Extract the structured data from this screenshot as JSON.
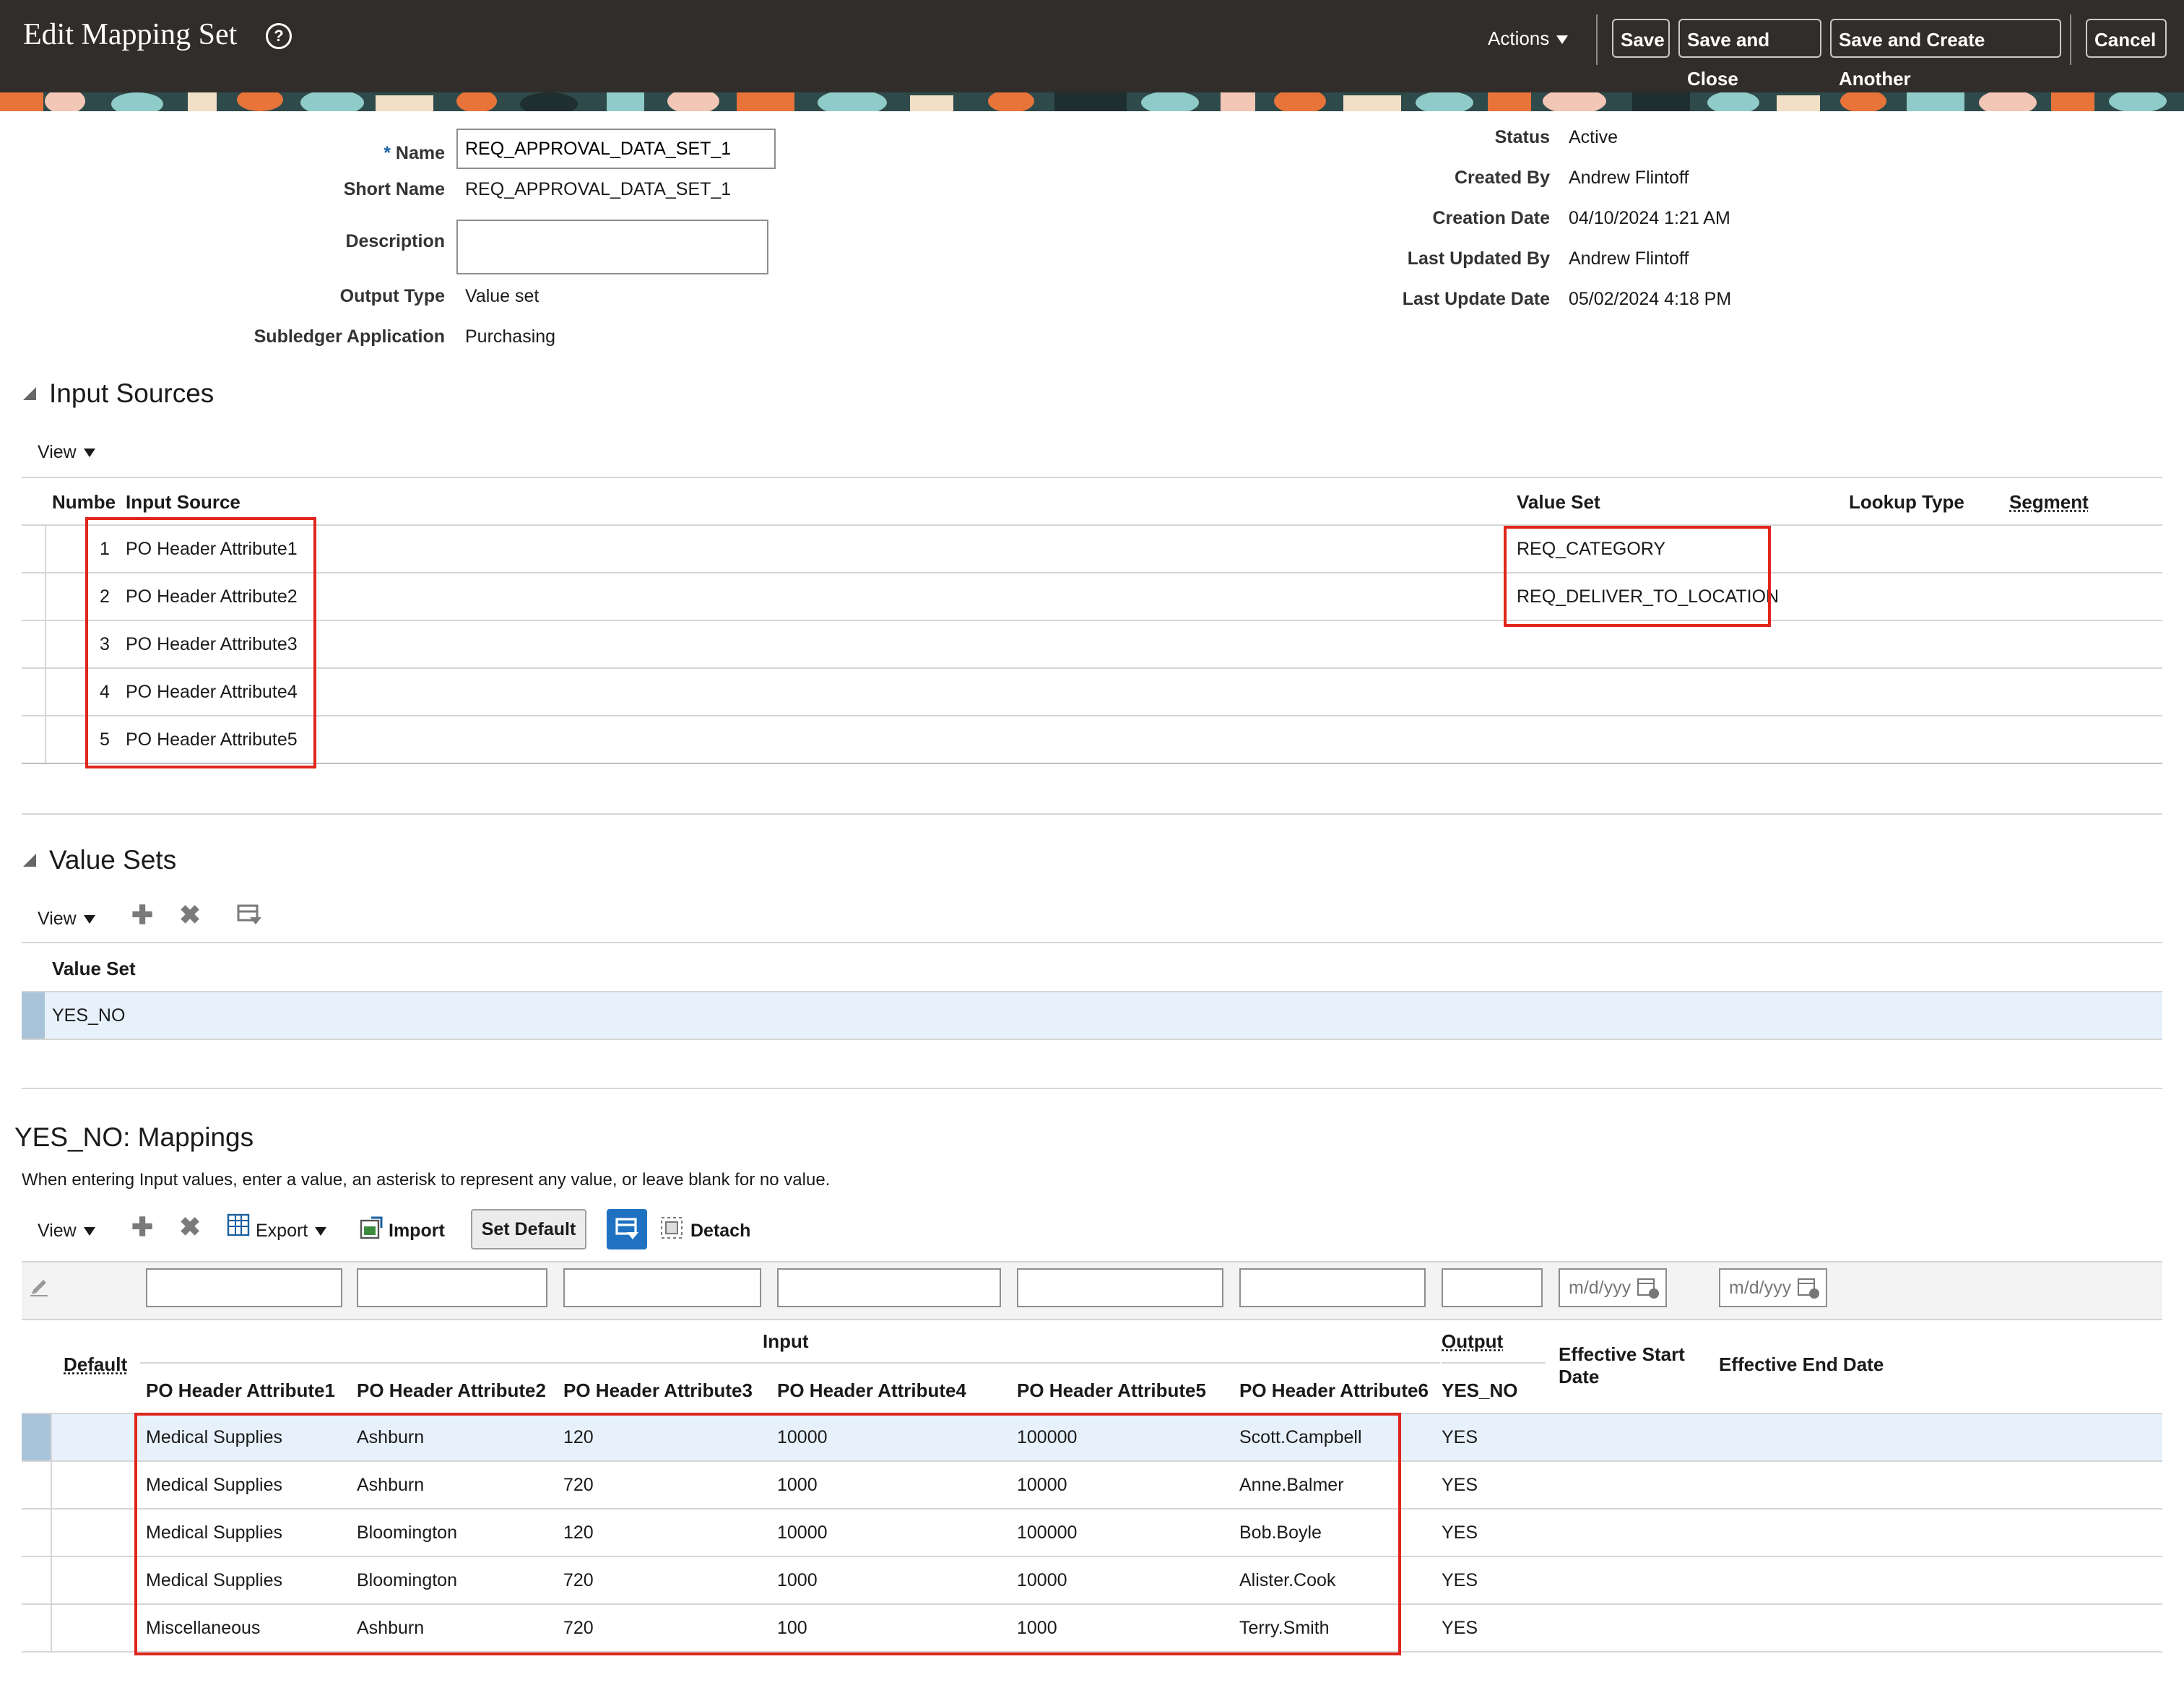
{
  "header": {
    "title": "Edit Mapping Set",
    "actions_label": "Actions",
    "buttons": {
      "save": "Save",
      "save_close": "Save and Close",
      "save_create": "Save and Create Another",
      "cancel": "Cancel"
    }
  },
  "form": {
    "name_label": "Name",
    "name_value": "REQ_APPROVAL_DATA_SET_1",
    "short_name_label": "Short Name",
    "short_name_value": "REQ_APPROVAL_DATA_SET_1",
    "description_label": "Description",
    "description_value": "",
    "output_type_label": "Output Type",
    "output_type_value": "Value set",
    "subledger_label": "Subledger Application",
    "subledger_value": "Purchasing",
    "status_label": "Status",
    "status_value": "Active",
    "created_by_label": "Created By",
    "created_by_value": "Andrew Flintoff",
    "creation_date_label": "Creation Date",
    "creation_date_value": "04/10/2024 1:21 AM",
    "updated_by_label": "Last Updated By",
    "updated_by_value": "Andrew Flintoff",
    "update_date_label": "Last Update Date",
    "update_date_value": "05/02/2024 4:18 PM"
  },
  "input_sources": {
    "title": "Input Sources",
    "view_label": "View",
    "columns": {
      "number": "Numbe",
      "source": "Input Source",
      "value_set": "Value Set",
      "lookup": "Lookup Type",
      "segment": "Segment"
    },
    "rows": [
      {
        "num": "1",
        "source": "PO Header Attribute1",
        "value_set": "REQ_CATEGORY"
      },
      {
        "num": "2",
        "source": "PO Header Attribute2",
        "value_set": "REQ_DELIVER_TO_LOCATION"
      },
      {
        "num": "3",
        "source": "PO Header Attribute3",
        "value_set": ""
      },
      {
        "num": "4",
        "source": "PO Header Attribute4",
        "value_set": ""
      },
      {
        "num": "5",
        "source": "PO Header Attribute5",
        "value_set": ""
      }
    ]
  },
  "value_sets": {
    "title": "Value Sets",
    "view_label": "View",
    "column": "Value Set",
    "rows": [
      "YES_NO"
    ]
  },
  "mappings": {
    "title": "YES_NO: Mappings",
    "hint": "When entering Input values, enter a value, an asterisk to represent any value, or leave blank for no value.",
    "view_label": "View",
    "export_label": "Export",
    "import_label": "Import",
    "set_default_label": "Set Default",
    "detach_label": "Detach",
    "date_placeholder": "m/d/yyy",
    "group_input": "Input",
    "group_output": "Output",
    "col_default": "Default",
    "cols": [
      "PO Header Attribute1",
      "PO Header Attribute2",
      "PO Header Attribute3",
      "PO Header Attribute4",
      "PO Header Attribute5",
      "PO Header Attribute6",
      "YES_NO"
    ],
    "col_start_1": "Effective Start",
    "col_start_2": "Date",
    "col_end": "Effective End Date",
    "rows": [
      [
        "Medical Supplies",
        "Ashburn",
        "120",
        "10000",
        "100000",
        "Scott.Campbell",
        "YES"
      ],
      [
        "Medical Supplies",
        "Ashburn",
        "720",
        "1000",
        "10000",
        "Anne.Balmer",
        "YES"
      ],
      [
        "Medical Supplies",
        "Bloomington",
        "120",
        "10000",
        "100000",
        "Bob.Boyle",
        "YES"
      ],
      [
        "Medical Supplies",
        "Bloomington",
        "720",
        "1000",
        "10000",
        "Alister.Cook",
        "YES"
      ],
      [
        "Miscellaneous",
        "Ashburn",
        "720",
        "100",
        "1000",
        "Terry.Smith",
        "YES"
      ]
    ]
  },
  "colors": {
    "header_bg": "#312d2a",
    "highlight": "#e0261b",
    "selected_row": "#e7f1fb",
    "accent": "#1a5f9f"
  }
}
